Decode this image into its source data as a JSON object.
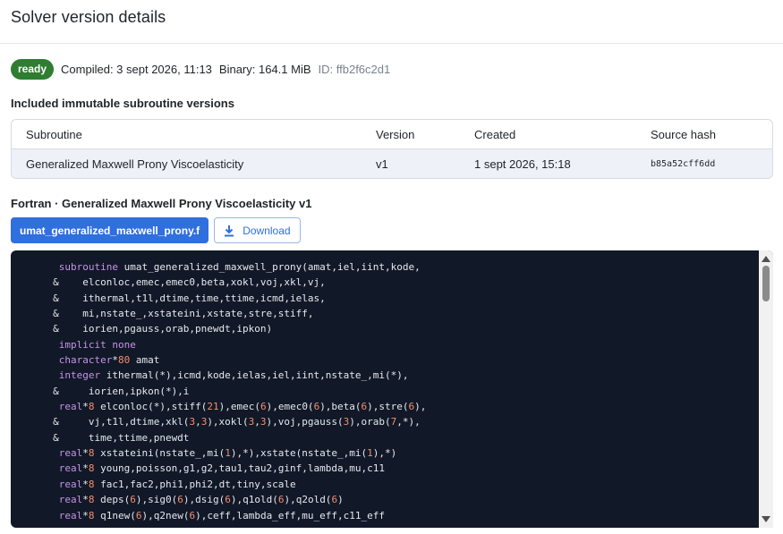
{
  "page": {
    "title": "Solver version details"
  },
  "meta": {
    "status": "ready",
    "compiled": "Compiled: 3 sept 2026, 11:13",
    "binary": "Binary: 164.1 MiB",
    "id": "ID: ffb2f6c2d1",
    "status_color": "#2e7d32"
  },
  "subroutines": {
    "section_title": "Included immutable subroutine versions",
    "columns": [
      "Subroutine",
      "Version",
      "Created",
      "Source hash"
    ],
    "rows": [
      {
        "subroutine": "Generalized Maxwell Prony Viscoelasticity",
        "version": "v1",
        "created": "1 sept 2026, 15:18",
        "hash": "b85a52cff6dd"
      }
    ]
  },
  "source": {
    "title": "Fortran · Generalized Maxwell Prony Viscoelasticity v1",
    "file_tab": "umat_generalized_maxwell_prony.f",
    "download_label": "Download",
    "download_icon": "download-icon",
    "accent": "#2f6fde",
    "code_lines": [
      "      subroutine umat_generalized_maxwell_prony(amat,iel,iint,kode,",
      "     &    elconloc,emec,emec0,beta,xokl,voj,xkl,vj,",
      "     &    ithermal,t1l,dtime,time,ttime,icmd,ielas,",
      "     &    mi,nstate_,xstateini,xstate,stre,stiff,",
      "     &    iorien,pgauss,orab,pnewdt,ipkon)",
      "      implicit none",
      "      character*80 amat",
      "      integer ithermal(*),icmd,kode,ielas,iel,iint,nstate_,mi(*),",
      "     &     iorien,ipkon(*),i",
      "      real*8 elconloc(*),stiff(21),emec(6),emec0(6),beta(6),stre(6),",
      "     &     vj,t1l,dtime,xkl(3,3),xokl(3,3),voj,pgauss(3),orab(7,*),",
      "     &     time,ttime,pnewdt",
      "      real*8 xstateini(nstate_,mi(1),*),xstate(nstate_,mi(1),*)",
      "      real*8 young,poisson,g1,g2,tau1,tau2,ginf,lambda,mu,c11",
      "      real*8 fac1,fac2,phi1,phi2,dt,tiny,scale",
      "      real*8 deps(6),sig0(6),dsig(6),q1old(6),q2old(6)",
      "      real*8 q1new(6),q2new(6),ceff,lambda_eff,mu_eff,c11_eff"
    ]
  }
}
